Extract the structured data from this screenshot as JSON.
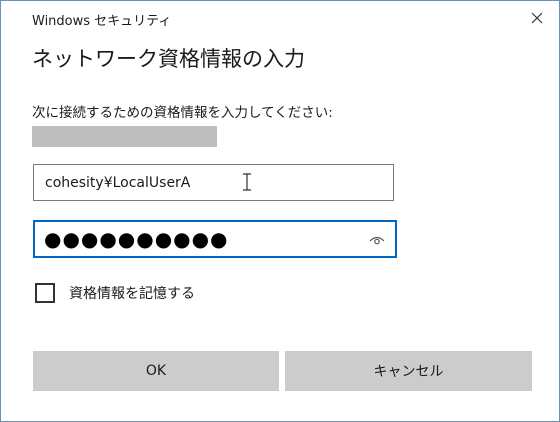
{
  "window": {
    "title": "Windows セキュリティ",
    "close_icon": "close-icon"
  },
  "dialog": {
    "heading": "ネットワーク資格情報の入力",
    "prompt": "次に接続するための資格情報を入力してください:"
  },
  "username": {
    "value": "cohesity¥LocalUserA"
  },
  "password": {
    "masked_value": "●●●●●●●●●●",
    "reveal_icon": "eye-icon"
  },
  "remember": {
    "label": "資格情報を記憶する",
    "checked": false
  },
  "buttons": {
    "ok_label": "OK",
    "cancel_label": "キャンセル"
  },
  "colors": {
    "focus_border": "#0067c0",
    "button_bg": "#cccccc",
    "window_border": "#6d8fb8",
    "redaction": "#bdbdbd"
  }
}
